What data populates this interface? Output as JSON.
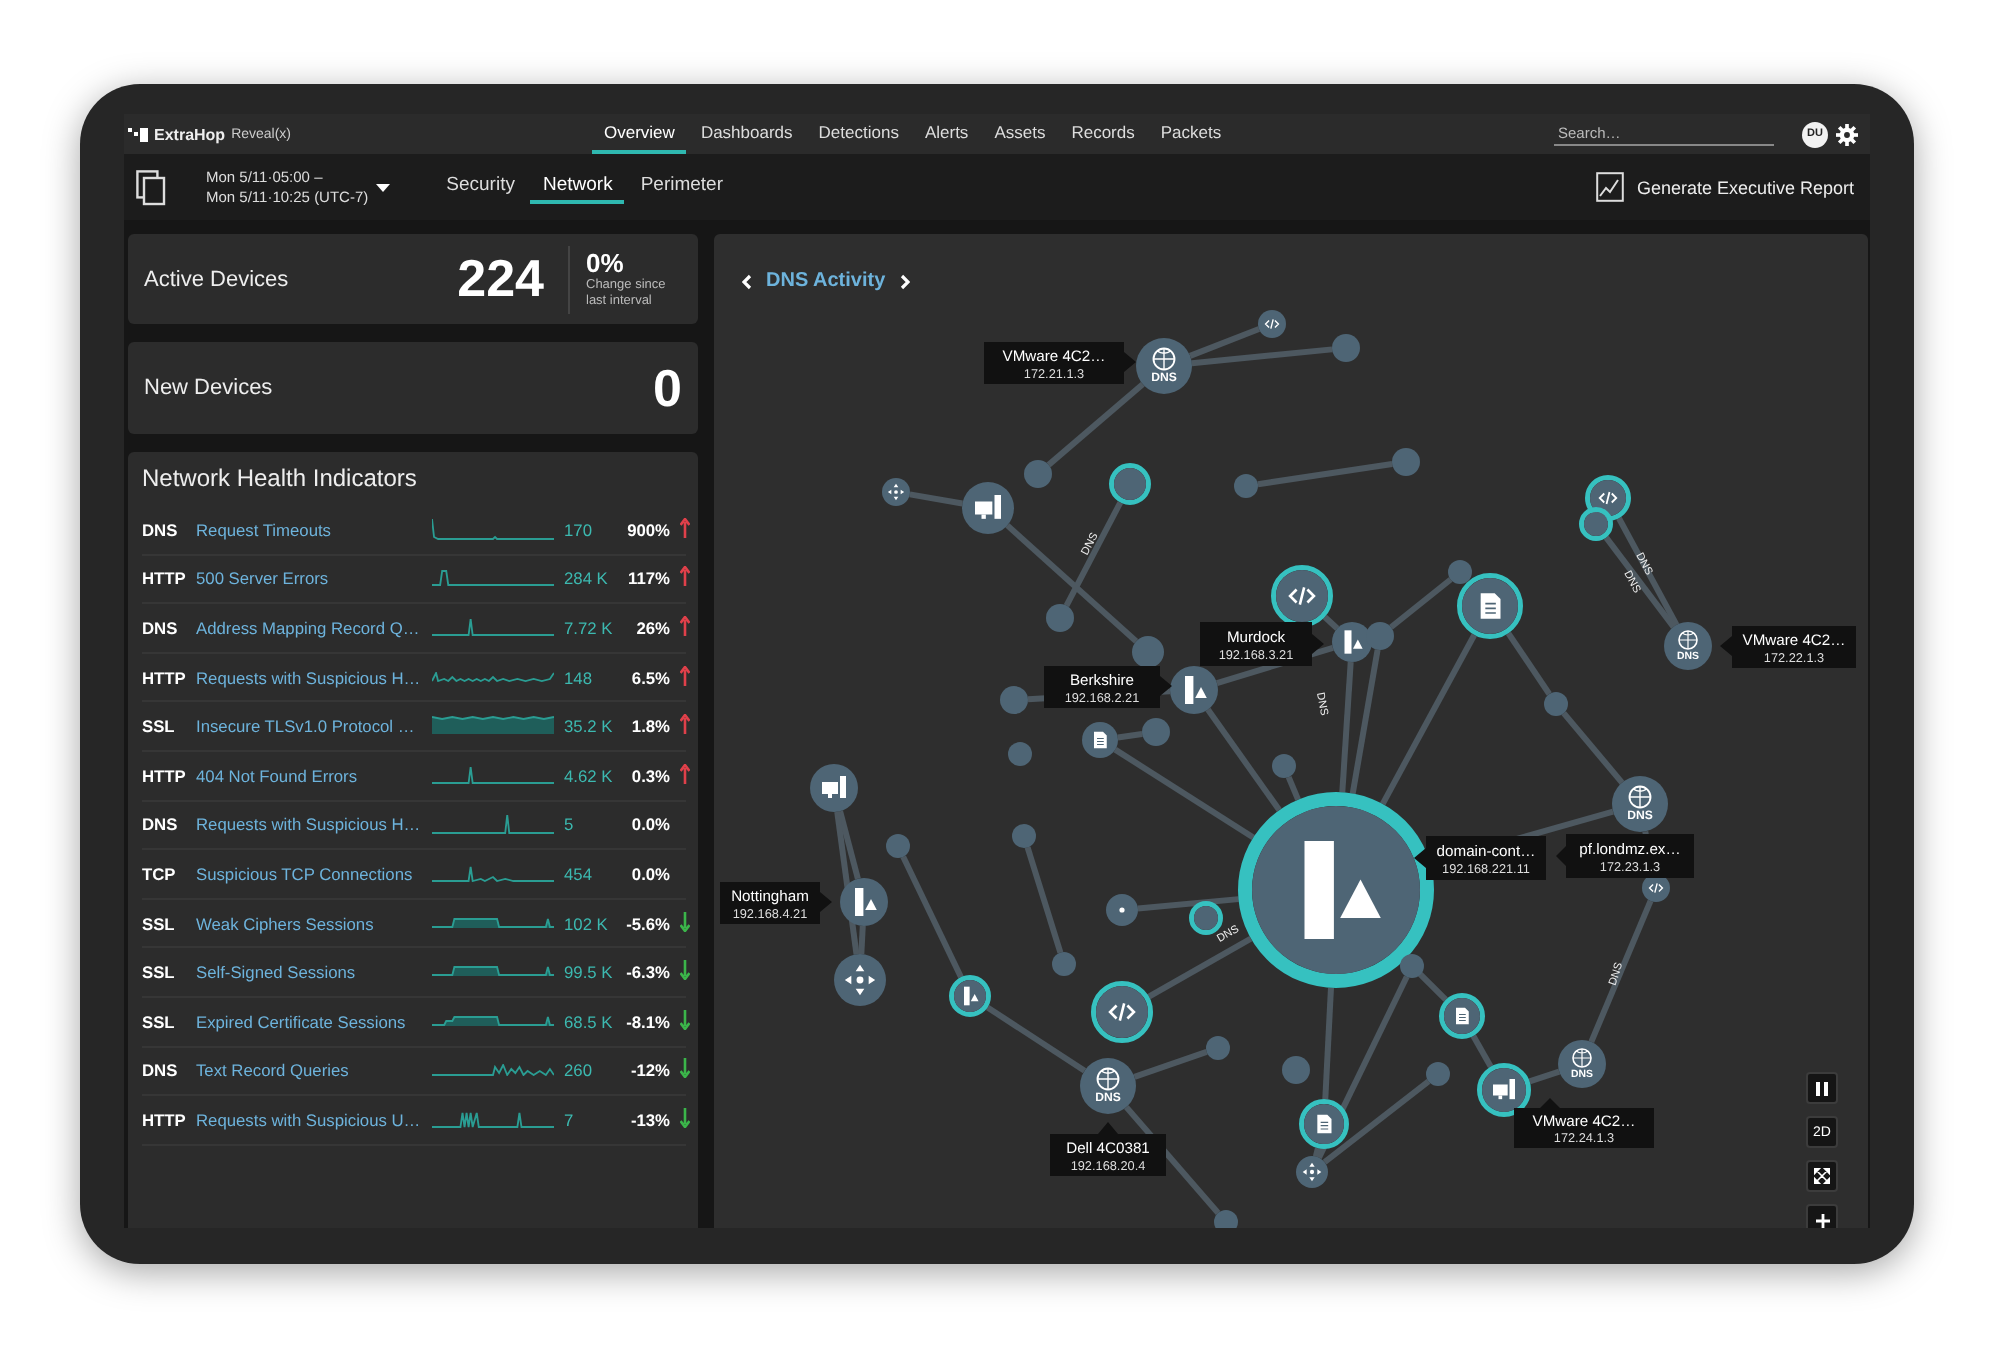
{
  "nav": {
    "brand": "ExtraHop",
    "product": "Reveal(x)",
    "search": {
      "placeholder": "Search…"
    },
    "avatar": "DU",
    "tabs": [
      {
        "label": "Overview",
        "selected": true
      },
      {
        "label": "Dashboards",
        "selected": false
      },
      {
        "label": "Detections",
        "selected": false
      },
      {
        "label": "Alerts",
        "selected": false
      },
      {
        "label": "Assets",
        "selected": false
      },
      {
        "label": "Records",
        "selected": false
      },
      {
        "label": "Packets",
        "selected": false
      }
    ]
  },
  "toolbar": {
    "date_start": "Mon 5/11·05:00 –",
    "date_end": "Mon 5/11·10:25 (UTC-7)",
    "report_button": "Generate Executive Report",
    "tabs": [
      {
        "label": "Security",
        "selected": false
      },
      {
        "label": "Network",
        "selected": true
      },
      {
        "label": "Perimeter",
        "selected": false
      }
    ]
  },
  "active_devices": {
    "label": "Active Devices",
    "count": "224",
    "change": "0%",
    "change_caption": "Change since last interval"
  },
  "new_devices": {
    "label": "New Devices",
    "count": "0"
  },
  "health": {
    "title": "Network Health Indicators",
    "rows": [
      {
        "protocol": "DNS",
        "name": "Request Timeouts",
        "value": "170",
        "change": "900%",
        "kind": "up"
      },
      {
        "protocol": "HTTP",
        "name": "500 Server Errors",
        "value": "284 K",
        "change": "117%",
        "kind": "up"
      },
      {
        "protocol": "DNS",
        "name": "Address Mapping Record Q…",
        "value": "7.72 K",
        "change": "26%",
        "kind": "up"
      },
      {
        "protocol": "HTTP",
        "name": "Requests with Suspicious H…",
        "value": "148",
        "change": "6.5%",
        "kind": "up"
      },
      {
        "protocol": "SSL",
        "name": "Insecure TLSv1.0 Protocol …",
        "value": "35.2 K",
        "change": "1.8%",
        "kind": "up"
      },
      {
        "protocol": "HTTP",
        "name": "404 Not Found Errors",
        "value": "4.62 K",
        "change": "0.3%",
        "kind": "up"
      },
      {
        "protocol": "DNS",
        "name": "Requests with Suspicious H…",
        "value": "5",
        "change": "0.0%",
        "kind": "flat"
      },
      {
        "protocol": "TCP",
        "name": "Suspicious TCP Connections",
        "value": "454",
        "change": "0.0%",
        "kind": "flat"
      },
      {
        "protocol": "SSL",
        "name": "Weak Ciphers Sessions",
        "value": "102 K",
        "change": "-5.6%",
        "kind": "down"
      },
      {
        "protocol": "SSL",
        "name": "Self-Signed Sessions",
        "value": "99.5 K",
        "change": "-6.3%",
        "kind": "down"
      },
      {
        "protocol": "SSL",
        "name": "Expired Certificate Sessions",
        "value": "68.5 K",
        "change": "-8.1%",
        "kind": "down"
      },
      {
        "protocol": "DNS",
        "name": "Text Record Queries",
        "value": "260",
        "change": "-12%",
        "kind": "down"
      },
      {
        "protocol": "HTTP",
        "name": "Requests with Suspicious U…",
        "value": "7",
        "change": "-13%",
        "kind": "down"
      }
    ]
  },
  "graph": {
    "title": "DNS Activity",
    "devices": [
      {
        "name": "VMware 4C2…",
        "ip": "172.21.1.3"
      },
      {
        "name": "Murdock",
        "ip": "192.168.3.21"
      },
      {
        "name": "VMware 4C2…",
        "ip": "172.22.1.3"
      },
      {
        "name": "Berkshire",
        "ip": "192.168.2.21"
      },
      {
        "name": "domain-cont…",
        "ip": "192.168.221.11"
      },
      {
        "name": "pf.londmz.ex…",
        "ip": "172.23.1.3"
      },
      {
        "name": "Nottingham",
        "ip": "192.168.4.21"
      },
      {
        "name": "Dell 4C0381",
        "ip": "192.168.20.4"
      },
      {
        "name": "VMware 4C2…",
        "ip": "172.24.1.3"
      }
    ],
    "dns_badges": [
      "DNS",
      "DNS",
      "DNS",
      "DNS",
      "DNS"
    ],
    "edge_labels": [
      "DNS",
      "DNS",
      "DNS",
      "DNS",
      "DNS",
      "DNS"
    ],
    "controls": [
      {
        "kind": "pause"
      },
      {
        "kind": "text",
        "label": "2D"
      },
      {
        "kind": "expand"
      },
      {
        "kind": "zoom-in"
      }
    ]
  }
}
